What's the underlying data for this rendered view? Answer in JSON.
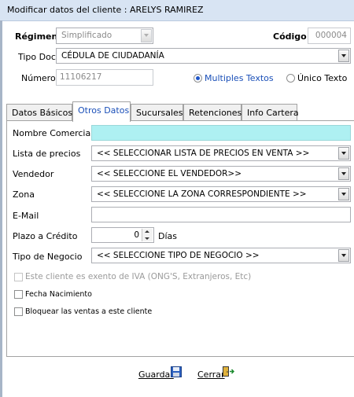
{
  "window": {
    "title": "Modificar datos del cliente : ARELYS RAMIREZ"
  },
  "header": {
    "regimen_label": "Régimen",
    "regimen_value": "Simplificado",
    "codigo_label": "Código",
    "codigo_value": "000004",
    "tipo_doc_label": "Tipo Doc",
    "tipo_doc_value": "CÉDULA DE CIUDADANÍA",
    "numero_label": "Número",
    "numero_value": "11106217",
    "radio_multiples": "Multiples Textos",
    "radio_unico": "Único Texto"
  },
  "tabs": [
    {
      "label": "Datos Básicos"
    },
    {
      "label": "Otros Datos"
    },
    {
      "label": "Sucursales"
    },
    {
      "label": "Retenciones"
    },
    {
      "label": "Info Cartera"
    }
  ],
  "form": {
    "nombre_comercial_label": "Nombre Comercial",
    "nombre_comercial_value": "",
    "lista_precios_label": "Lista de precios",
    "lista_precios_value": "<< SELECCIONAR LISTA DE PRECIOS EN VENTA >>",
    "vendedor_label": "Vendedor",
    "vendedor_value": "<< SELECCIONE EL VENDEDOR>>",
    "zona_label": "Zona",
    "zona_value": "<< SELECCIONE LA ZONA CORRESPONDIENTE >>",
    "email_label": "E-Mail",
    "email_value": "",
    "plazo_label": "Plazo a Crédito",
    "plazo_value": "0",
    "plazo_unit": "Días",
    "tipo_negocio_label": "Tipo de Negocio",
    "tipo_negocio_value": "<< SELECCIONE TIPO DE NEGOCIO >>",
    "exento_iva_label": "Este cliente es exento de IVA (ONG'S, Extranjeros, Etc)",
    "fecha_nacimiento_label": "Fecha Nacimiento",
    "bloquear_label": "Bloquear las ventas a este cliente"
  },
  "footer": {
    "guardar_label": "Guardar",
    "cerrar_label": "Cerrar"
  },
  "colors": {
    "titlebar": "#d8e4f3",
    "active_tab_text": "#1a4fb8",
    "highlight_input": "#aef0f2"
  },
  "icons": [
    "floppy-disk-icon",
    "exit-door-icon"
  ]
}
